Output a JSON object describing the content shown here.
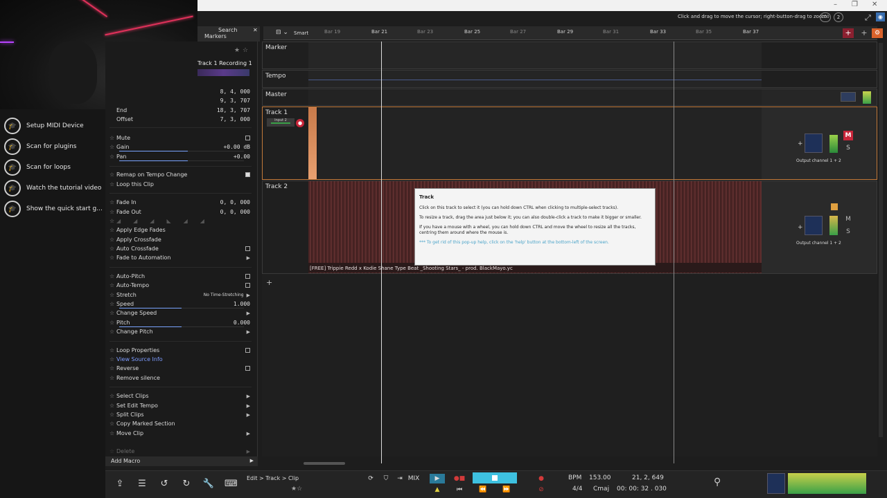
{
  "titlebar": {
    "hint": "Click and drag to move the cursor; right-button-drag to zoom",
    "zoom_value": "100",
    "help_number": "2"
  },
  "search_panel": {
    "search_label": "Search",
    "markers_label": "Markers"
  },
  "clip_panel": {
    "title": "Track 1 Recording 1",
    "position_rows": [
      {
        "label": "",
        "value": "8, 4, 000"
      },
      {
        "label": "",
        "value": "9, 3, 707"
      },
      {
        "label": "End",
        "value": "18, 3, 707"
      },
      {
        "label": "Offset",
        "value": "7, 3, 000"
      }
    ],
    "mute": "Mute",
    "gain": {
      "label": "Gain",
      "value": "+0.00 dB",
      "level": 0.55
    },
    "pan": {
      "label": "Pan",
      "value": "+0.00",
      "level": 0.55
    },
    "remap": "Remap on Tempo Change",
    "loop_clip": "Loop this Clip",
    "fade_in": {
      "label": "Fade In",
      "value": "0, 0, 000"
    },
    "fade_out": {
      "label": "Fade Out",
      "value": "0, 0, 000"
    },
    "apply_edge_fades": "Apply Edge Fades",
    "apply_crossfade": "Apply Crossfade",
    "auto_crossfade": "Auto Crossfade",
    "fade_to_automation": "Fade to Automation",
    "auto_pitch": "Auto-Pitch",
    "auto_tempo": "Auto-Tempo",
    "stretch": {
      "label": "Stretch",
      "value": "No Time-Stretching"
    },
    "speed": {
      "label": "Speed",
      "value": "1.000",
      "level": 0.5
    },
    "change_speed": "Change Speed",
    "pitch": {
      "label": "Pitch",
      "value": "0.000",
      "level": 0.5
    },
    "change_pitch": "Change Pitch",
    "loop_properties": "Loop Properties",
    "view_source_info": "View Source Info",
    "reverse": "Reverse",
    "remove_silence": "Remove silence",
    "select_clips": "Select Clips",
    "set_edit_tempo": "Set Edit Tempo",
    "split_clips": "Split Clips",
    "copy_marked_section": "Copy Marked Section",
    "move_clip": "Move Clip",
    "delete": "Delete",
    "add_macro": "Add Macro"
  },
  "help_panel": {
    "items": [
      "Setup MIDI Device",
      "Scan for plugins",
      "Scan for loops",
      "Watch the tutorial video",
      "Show the quick start g..."
    ]
  },
  "ruler": {
    "snap_label": "Smart",
    "bars": [
      {
        "label": "Bar 19",
        "major": false
      },
      {
        "label": "Bar 21",
        "major": true
      },
      {
        "label": "Bar 23",
        "major": false
      },
      {
        "label": "Bar 25",
        "major": true
      },
      {
        "label": "Bar 27",
        "major": false
      },
      {
        "label": "Bar 29",
        "major": true
      },
      {
        "label": "Bar 31",
        "major": false
      },
      {
        "label": "Bar 33",
        "major": true
      },
      {
        "label": "Bar 35",
        "major": false
      },
      {
        "label": "Bar 37",
        "major": true
      }
    ]
  },
  "tracks": {
    "marker": "Marker",
    "tempo": "Tempo",
    "master": "Master",
    "track1": {
      "name": "Track 1",
      "input": "Input 2",
      "output": "Output channel 1 + 2",
      "mute_label": "M",
      "solo_label": "S"
    },
    "track2": {
      "name": "Track 2",
      "clip_name": "[FREE] Trippie Redd x Kodie Shane Type Beat _Shooting Stars_ - prod. BlackMayo.yc",
      "output": "Output channel 1 + 2",
      "mute_label": "M",
      "solo_label": "S"
    }
  },
  "popup": {
    "title": "Track",
    "p1": "Click on this track to select it (you can hold down CTRL when clicking to multiple-select tracks).",
    "p2": "To resize a track, drag the area just below it; you can also double-click a track to make it bigger or smaller.",
    "p3": "If you have a mouse with a wheel, you can hold down CTRL and move the wheel to resize all the tracks, centring them around where the mouse is.",
    "hint": "*** To get rid of this pop-up help, click on the 'help' button at the bottom-left of the screen."
  },
  "bottom": {
    "breadcrumb": "Edit > Track > Clip",
    "bpm_label": "BPM",
    "bpm_value": "153.00",
    "position": "21, 2, 649",
    "time_sig": "4/4",
    "key": "Cmaj",
    "time": "00: 00: 32 . 030",
    "mix_label": "MIX"
  },
  "colors": {
    "accent_blue": "#3ec1e0",
    "record_red": "#d33a3a",
    "clip_red": "#5a2a2a",
    "mute_red": "#c8263a"
  }
}
